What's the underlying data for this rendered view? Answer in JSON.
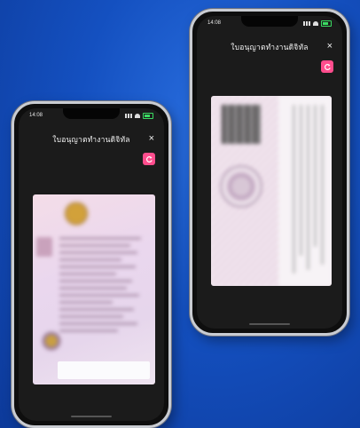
{
  "phones": [
    {
      "id": "front",
      "status": {
        "time": "14:08"
      },
      "header": {
        "title": "ใบอนุญาตทำงานดิจิทัล",
        "close_symbol": "×"
      },
      "card": {
        "side": "front"
      }
    },
    {
      "id": "back",
      "status": {
        "time": "14:08"
      },
      "header": {
        "title": "ใบอนุญาตทำงานดิจิทัล",
        "close_symbol": "×"
      },
      "card": {
        "side": "back"
      }
    }
  ],
  "colors": {
    "background": "#1450c0",
    "accent_rotate_button": "#ff4d8d",
    "phone_screen": "#1b1b1b",
    "battery": "#3bdc63"
  },
  "icons": {
    "rotate": "rotate-icon",
    "close": "close-icon",
    "signal": "signal-icon",
    "wifi": "wifi-icon",
    "battery": "battery-icon"
  }
}
